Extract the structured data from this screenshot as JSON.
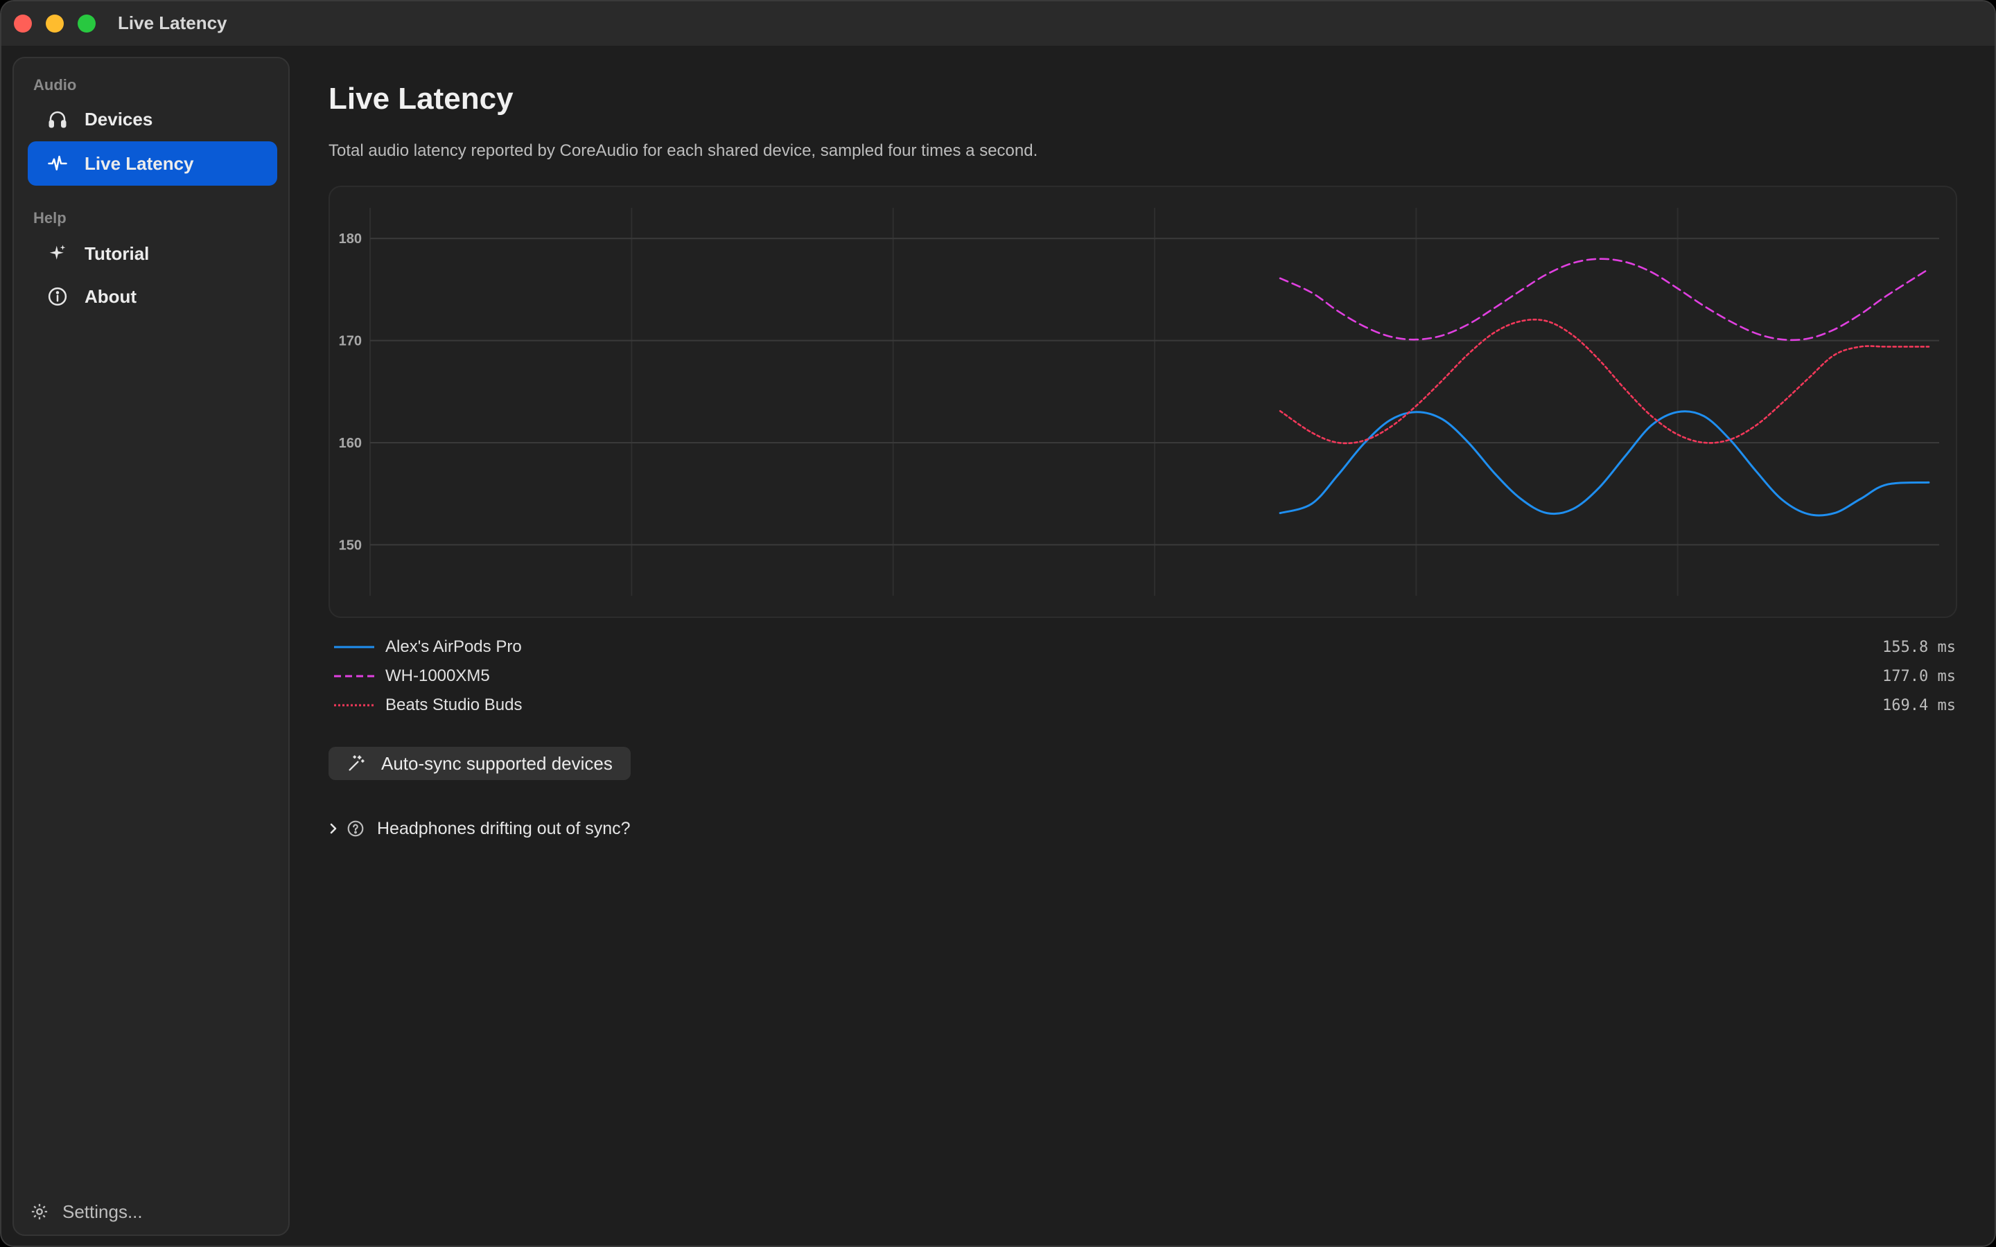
{
  "window": {
    "title": "Live Latency"
  },
  "sidebar": {
    "sections": [
      {
        "label": "Audio",
        "items": [
          {
            "label": "Devices",
            "icon": "headphones-icon",
            "active": false
          },
          {
            "label": "Live Latency",
            "icon": "waveform-icon",
            "active": true
          }
        ]
      },
      {
        "label": "Help",
        "items": [
          {
            "label": "Tutorial",
            "icon": "sparkle-icon",
            "active": false
          },
          {
            "label": "About",
            "icon": "info-icon",
            "active": false
          }
        ]
      }
    ],
    "settings_label": "Settings..."
  },
  "main": {
    "title": "Live Latency",
    "description": "Total audio latency reported by CoreAudio for each shared device, sampled four times a second.",
    "autosync_label": "Auto-sync supported devices",
    "disclosure_label": "Headphones drifting out of sync?"
  },
  "colors": {
    "accent": "#0a5bd6",
    "series_airpods": "#1f8ff0",
    "series_wh": "#e040e0",
    "series_beats": "#f2385a"
  },
  "chart_data": {
    "type": "line",
    "title": "",
    "xlabel": "",
    "ylabel": "",
    "ylim": [
      145,
      183
    ],
    "yticks": [
      150,
      160,
      170,
      180
    ],
    "xlim": [
      0,
      60
    ],
    "x_gridlines": [
      10,
      20,
      30,
      40,
      50
    ],
    "grid": true,
    "legend_position": "below",
    "series": [
      {
        "name": "Alex's AirPods Pro",
        "style": "solid",
        "color": "#1f8ff0",
        "x": [
          34.8,
          36,
          37,
          38,
          39,
          40,
          41,
          42,
          43,
          44,
          45,
          46,
          47,
          48,
          49,
          50,
          51,
          52,
          53,
          54,
          55,
          56,
          57,
          58,
          59.6
        ],
        "y": [
          153.1,
          154.0,
          156.8,
          159.9,
          162.2,
          163.0,
          162.3,
          160.0,
          157.0,
          154.5,
          153.1,
          153.5,
          155.6,
          158.7,
          161.7,
          163.0,
          162.6,
          160.3,
          157.2,
          154.4,
          153.0,
          153.1,
          154.5,
          155.9,
          156.1
        ]
      },
      {
        "name": "WH-1000XM5",
        "style": "dashed",
        "color": "#e040e0",
        "x": [
          34.8,
          36,
          37,
          38,
          39,
          40,
          41,
          42,
          43,
          44,
          45,
          46,
          47,
          48,
          49,
          50,
          51,
          52,
          53,
          54,
          55,
          56,
          57,
          58,
          59.6
        ],
        "y": [
          176.1,
          174.7,
          172.9,
          171.4,
          170.4,
          170.1,
          170.5,
          171.6,
          173.2,
          174.9,
          176.5,
          177.6,
          178.0,
          177.7,
          176.7,
          175.1,
          173.4,
          171.9,
          170.7,
          170.1,
          170.2,
          171.1,
          172.6,
          174.4,
          177.0
        ]
      },
      {
        "name": "Beats Studio Buds",
        "style": "dotted",
        "color": "#f2385a",
        "x": [
          34.8,
          36,
          37,
          38,
          39,
          40,
          41,
          42,
          43,
          44,
          45,
          46,
          47,
          48,
          49,
          50,
          51,
          52,
          53,
          54,
          55,
          56,
          57,
          58,
          59.6
        ],
        "y": [
          163.1,
          161.0,
          160.0,
          160.2,
          161.5,
          163.6,
          166.1,
          168.7,
          170.8,
          171.9,
          171.9,
          170.5,
          168.1,
          165.2,
          162.6,
          160.8,
          160.0,
          160.3,
          161.7,
          163.9,
          166.3,
          168.6,
          169.4,
          169.4,
          169.4
        ]
      }
    ]
  },
  "legend": [
    {
      "name": "Alex's AirPods Pro",
      "value": "155.8 ms",
      "color": "#1f8ff0",
      "style": "solid"
    },
    {
      "name": "WH-1000XM5",
      "value": "177.0 ms",
      "color": "#e040e0",
      "style": "dashed"
    },
    {
      "name": "Beats Studio Buds",
      "value": "169.4 ms",
      "color": "#f2385a",
      "style": "dotted"
    }
  ]
}
